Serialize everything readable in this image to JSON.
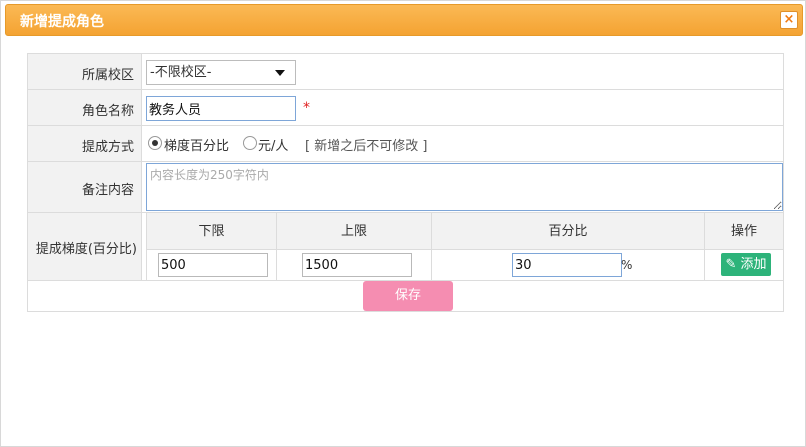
{
  "dialog": {
    "title": "新增提成角色",
    "close_label": "×"
  },
  "form": {
    "campus": {
      "label": "所属校区",
      "selected": "-不限校区-"
    },
    "role_name": {
      "label": "角色名称",
      "value": "教务人员",
      "required_mark": "*"
    },
    "commission_method": {
      "label": "提成方式",
      "options": [
        {
          "label": "梯度百分比",
          "checked": true
        },
        {
          "label": "元/人",
          "checked": false
        }
      ],
      "hint": "[ 新增之后不可修改 ]"
    },
    "remark": {
      "label": "备注内容",
      "placeholder": "内容长度为250字符内",
      "value": ""
    },
    "gradient": {
      "label": "提成梯度(百分比)",
      "columns": [
        "下限",
        "上限",
        "百分比",
        "操作"
      ],
      "row": {
        "lower": "500",
        "upper": "1500",
        "percent": "30",
        "percent_unit": "%"
      },
      "add_label": "添加",
      "add_icon": "edit-icon"
    }
  },
  "actions": {
    "save_label": "保存"
  },
  "colors": {
    "titlebar": "#f4a332",
    "save_button": "#f58db1",
    "add_button": "#2db37a",
    "required": "#e02020"
  }
}
